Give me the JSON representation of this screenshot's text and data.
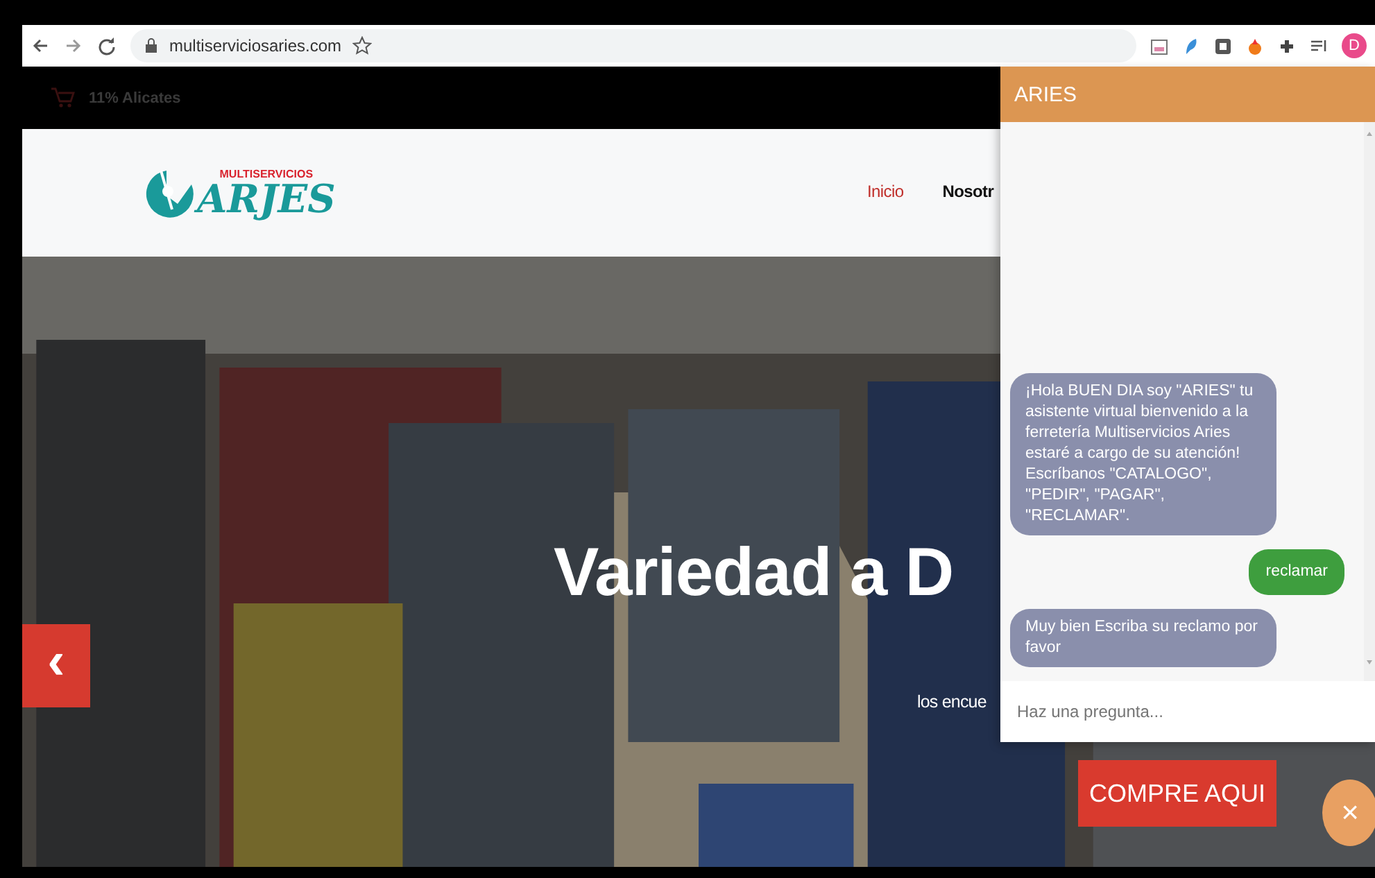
{
  "browser": {
    "url": "multiserviciosaries.com",
    "profile_initial": "D"
  },
  "top_bar": {
    "promo": "11% Alicates"
  },
  "header": {
    "logo": {
      "small": "MULTISERVICIOS",
      "big": "ARJES"
    },
    "nav": [
      {
        "label": "Inicio",
        "selected": true
      },
      {
        "label": "Nosotr",
        "selected": false
      }
    ]
  },
  "hero": {
    "kind": "picture",
    "title": "Variedad a D",
    "subtitle": "los encue",
    "prev": "‹",
    "cta": "COMPRE AQUI"
  },
  "chat": {
    "title": "ARIES",
    "messages": [
      {
        "kind": "bot",
        "text": "¡Hola BUEN DIA soy \"ARIES\" tu asistente virtual bienvenido a la ferretería Multiservicios Aries estaré a cargo de su atención! Escríbanos \"CATALOGO\", \"PEDIR\", \"PAGAR\", \"RECLAMAR\"."
      },
      {
        "kind": "user",
        "text": "reclamar"
      },
      {
        "kind": "bot",
        "text": "Muy bien Escriba su reclamo por favor"
      }
    ],
    "input": {
      "placeholder": "Haz una pregunta..."
    },
    "close": "×"
  }
}
